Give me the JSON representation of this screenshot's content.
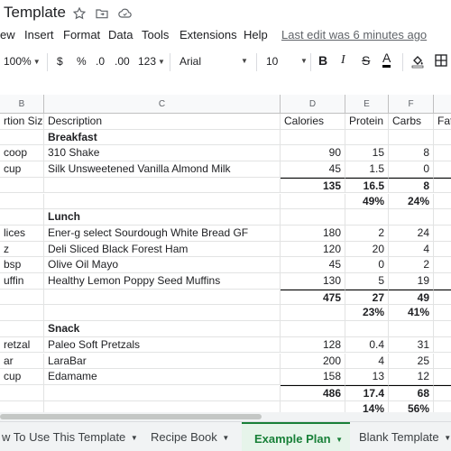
{
  "doc": {
    "title": "Template"
  },
  "menu": {
    "items": [
      "ew",
      "Insert",
      "Format",
      "Data",
      "Tools",
      "Extensions",
      "Help"
    ],
    "last_edit": "Last edit was 6 minutes ago"
  },
  "toolbar": {
    "zoom": "100%",
    "currency": "$",
    "percent": "%",
    "dec_decrease": ".0",
    "dec_increase": ".00",
    "more_formats": "123",
    "font": "Arial",
    "font_size": "10",
    "bold": "B",
    "italic": "I",
    "strike": "S",
    "text_color": "A"
  },
  "columns": [
    {
      "key": "B",
      "header": "B"
    },
    {
      "key": "C",
      "header": "C"
    },
    {
      "key": "D",
      "header": "D"
    },
    {
      "key": "E",
      "header": "E"
    },
    {
      "key": "F",
      "header": "F"
    }
  ],
  "rows": [
    {
      "cells": [
        "rtion Size",
        "Description",
        "Calories",
        "Protein",
        "Carbs",
        "Fat"
      ]
    },
    {
      "cells": [
        "",
        "Breakfast",
        "",
        "",
        "",
        ""
      ],
      "bold_desc": true
    },
    {
      "cells": [
        "coop",
        "310 Shake",
        "90",
        "15",
        "8",
        ""
      ]
    },
    {
      "cells": [
        " cup",
        "Silk Unsweetened Vanilla Almond Milk",
        "45",
        "1.5",
        "0",
        ""
      ]
    },
    {
      "cells": [
        "",
        "",
        "135",
        "16.5",
        "8",
        ""
      ],
      "total": true
    },
    {
      "cells": [
        "",
        "",
        "",
        "49%",
        "24%",
        ""
      ],
      "pct": true
    },
    {
      "cells": [
        "",
        "Lunch",
        "",
        "",
        "",
        ""
      ],
      "bold_desc": true
    },
    {
      "cells": [
        "lices",
        "Ener-g select Sourdough White Bread GF",
        "180",
        "2",
        "24",
        ""
      ]
    },
    {
      "cells": [
        "z",
        "Deli Sliced Black Forest Ham",
        "120",
        "20",
        "4",
        ""
      ]
    },
    {
      "cells": [
        "bsp",
        "Olive Oil Mayo",
        "45",
        "0",
        "2",
        ""
      ]
    },
    {
      "cells": [
        "uffin",
        "Healthy Lemon Poppy Seed Muffins",
        "130",
        "5",
        "19",
        ""
      ]
    },
    {
      "cells": [
        "",
        "",
        "475",
        "27",
        "49",
        ""
      ],
      "total": true
    },
    {
      "cells": [
        "",
        "",
        "",
        "23%",
        "41%",
        ""
      ],
      "pct": true
    },
    {
      "cells": [
        "",
        "Snack",
        "",
        "",
        "",
        ""
      ],
      "bold_desc": true
    },
    {
      "cells": [
        "retzal",
        "Paleo Soft Pretzals",
        "128",
        "0.4",
        "31",
        ""
      ]
    },
    {
      "cells": [
        "ar",
        "LaraBar",
        "200",
        "4",
        "25",
        ""
      ]
    },
    {
      "cells": [
        " cup",
        "Edamame",
        "158",
        "13",
        "12",
        ""
      ]
    },
    {
      "cells": [
        "",
        "",
        "486",
        "17.4",
        "68",
        ""
      ],
      "total": true
    },
    {
      "cells": [
        "",
        "",
        "",
        "14%",
        "56%",
        ""
      ],
      "pct": true
    }
  ],
  "sheets": [
    {
      "label": "w To Use This Template",
      "active": false
    },
    {
      "label": "Recipe Book",
      "active": false
    },
    {
      "label": "Example Plan",
      "active": true
    },
    {
      "label": "Blank Template",
      "active": false
    }
  ],
  "colors": {
    "accent_green": "#188038",
    "active_tab_bg": "#e6f4ea"
  }
}
